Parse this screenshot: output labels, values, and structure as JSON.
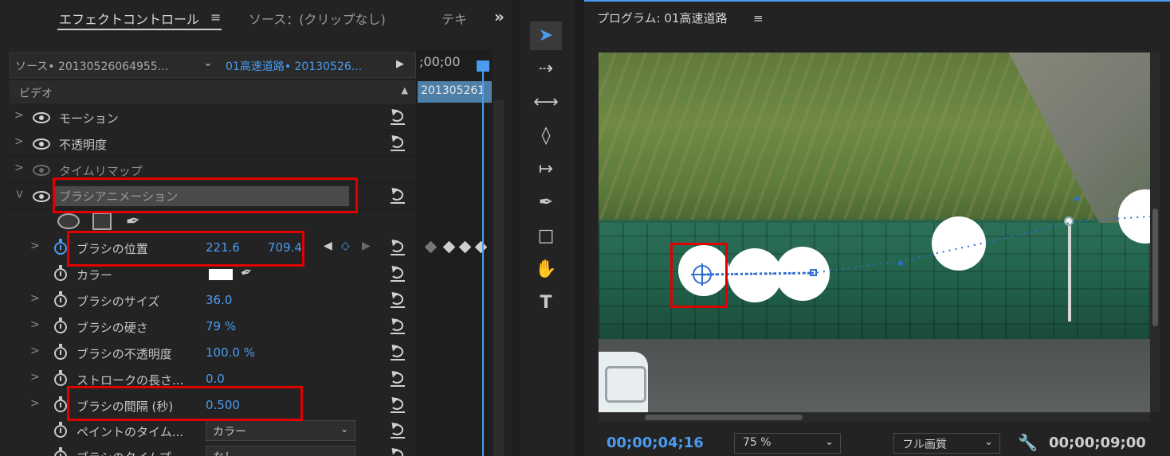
{
  "effect_controls": {
    "tabs": {
      "effect_controls": "エフェクトコントロール",
      "source": "ソース：(クリップなし)",
      "text_truncated": "テキ",
      "menu_glyph": "≡",
      "overflow_glyph": "»"
    },
    "source_clip": "ソース• 20130526064955...",
    "sequence_clip": "01高速道路• 20130526...",
    "video_header": "ビデオ",
    "effects": [
      {
        "name": "モーション",
        "visible": true
      },
      {
        "name": "不透明度",
        "visible": true
      },
      {
        "name": "タイムリマップ",
        "visible": false
      },
      {
        "name": "ブラシアニメーション",
        "visible": true
      }
    ],
    "properties": {
      "position": {
        "label": "ブラシの位置",
        "x": "221.6",
        "y": "709.4"
      },
      "color": {
        "label": "カラー",
        "swatch": "#ffffff"
      },
      "size": {
        "label": "ブラシのサイズ",
        "value": "36.0"
      },
      "hardness": {
        "label": "ブラシの硬さ",
        "value": "79 %"
      },
      "opacity": {
        "label": "ブラシの不透明度",
        "value": "100.0 %"
      },
      "stroke_length": {
        "label": "ストロークの長さ...",
        "value": "0.0"
      },
      "interval": {
        "label": "ブラシの間隔 (秒)",
        "value": "0.500"
      },
      "paint_time": {
        "label": "ペイントのタイム...",
        "value": "カラー"
      },
      "brush_time": {
        "label": "ブラシのタイムプ...",
        "value": "なし"
      }
    },
    "timeline": {
      "timecode": ";00;00",
      "clip_label": "201305261"
    }
  },
  "program_monitor": {
    "title": "プログラム: 01高速道路",
    "menu_glyph": "≡",
    "current_timecode": "00;00;04;16",
    "zoom": "75 %",
    "quality": "フル画質",
    "duration_timecode": "00;00;09;00"
  },
  "colors": {
    "accent": "#4b9cf0",
    "highlight": "#e00000",
    "panel": "#232323"
  }
}
